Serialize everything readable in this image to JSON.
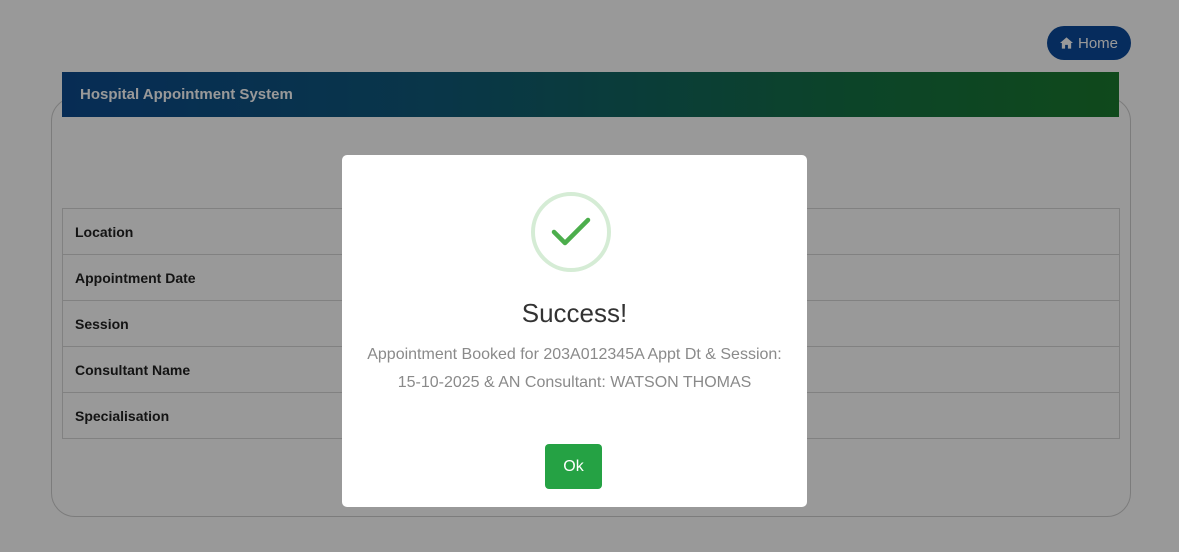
{
  "header": {
    "home_label": "Home"
  },
  "banner": {
    "title": "Hospital Appointment System"
  },
  "details": {
    "rows": [
      {
        "label": "Location"
      },
      {
        "label": "Appointment Date"
      },
      {
        "label": "Session"
      },
      {
        "label": "Consultant Name"
      },
      {
        "label": "Specialisation"
      }
    ]
  },
  "modal": {
    "title": "Success!",
    "message": "Appointment Booked for 203A012345A Appt Dt & Session: 15-10-2025 & AN Consultant: WATSON THOMAS",
    "ok_label": "Ok"
  },
  "colors": {
    "home_button": "#0b4a9c",
    "banner_start": "#0c4a8e",
    "banner_end": "#1a7a2e",
    "success_check": "#4cae4c",
    "ok_button": "#25a244"
  },
  "icons": {
    "home": "home-icon",
    "success": "check-icon"
  }
}
